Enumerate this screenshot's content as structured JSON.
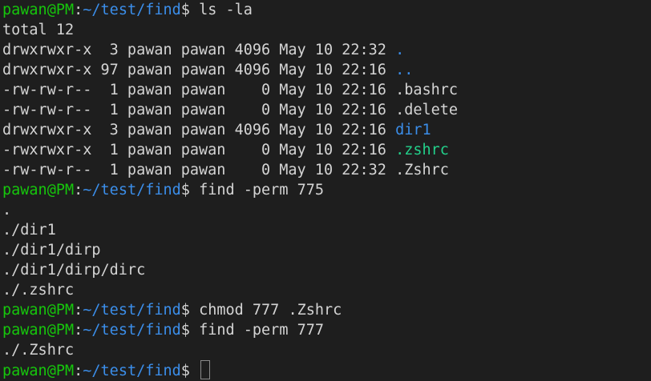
{
  "prompt": {
    "user": "pawan",
    "at": "@",
    "host": "PM",
    "colon": ":",
    "path": "~/test/find",
    "dollar": "$"
  },
  "commands": [
    "ls -la",
    "find -perm 775",
    "chmod 777 .Zshrc",
    "find -perm 777"
  ],
  "ls_output": {
    "total": "total 12",
    "entries": [
      {
        "meta": "drwxrwxr-x  3 pawan pawan 4096 May 10 22:32 ",
        "name": ".",
        "kind": "dir"
      },
      {
        "meta": "drwxrwxr-x 97 pawan pawan 4096 May 10 22:16 ",
        "name": "..",
        "kind": "dir"
      },
      {
        "meta": "-rw-rw-r--  1 pawan pawan    0 May 10 22:16 ",
        "name": ".bashrc",
        "kind": "file"
      },
      {
        "meta": "-rw-rw-r--  1 pawan pawan    0 May 10 22:16 ",
        "name": ".delete",
        "kind": "file"
      },
      {
        "meta": "drwxrwxr-x  3 pawan pawan 4096 May 10 22:16 ",
        "name": "dir1",
        "kind": "dir"
      },
      {
        "meta": "-rwxrwxr-x  1 pawan pawan    0 May 10 22:16 ",
        "name": ".zshrc",
        "kind": "exec"
      },
      {
        "meta": "-rw-rw-r--  1 pawan pawan    0 May 10 22:32 ",
        "name": ".Zshrc",
        "kind": "file"
      }
    ]
  },
  "find775_output": [
    ".",
    "./dir1",
    "./dir1/dirp",
    "./dir1/dirp/dirc",
    "./.zshrc"
  ],
  "find777_output": [
    "./.Zshrc"
  ],
  "colors": {
    "prompt_green": "#16c60c",
    "path_blue": "#3b8eea",
    "exec_green": "#23d18b",
    "background": "#1e1e1e",
    "text": "#d4d4d4"
  }
}
